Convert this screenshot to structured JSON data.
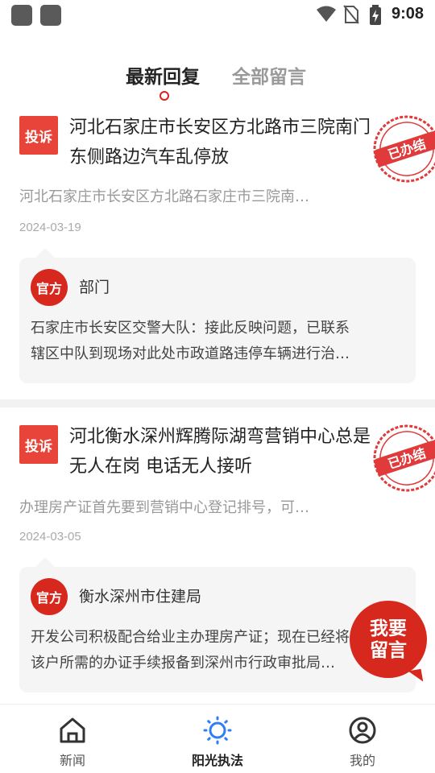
{
  "status_bar": {
    "time": "9:08"
  },
  "tabs": [
    {
      "label": "最新回复",
      "active": true
    },
    {
      "label": "全部留言",
      "active": false
    }
  ],
  "items": [
    {
      "badge": "投诉",
      "title_line1": "河北石家庄市长安区方北路市三院南门",
      "title_line2": "东侧路边汽车乱停放",
      "summary": "河北石家庄市长安区方北路石家庄市三院南…",
      "date": "2024-03-19",
      "stamp": "已办结",
      "reply": {
        "official_label": "官方",
        "department": "部门",
        "line1": "石家庄市长安区交警大队：接此反映问题，已联系",
        "line2": "辖区中队到现场对此处市政道路违停车辆进行治…"
      }
    },
    {
      "badge": "投诉",
      "title_line1": "河北衡水深州辉腾际湖弯营销中心总是",
      "title_line2": "无人在岗 电话无人接听",
      "summary": "办理房产证首先要到营销中心登记排号，可…",
      "date": "2024-03-05",
      "stamp": "已办结",
      "reply": {
        "official_label": "官方",
        "department": "衡水深州市住建局",
        "line1": "开发公司积极配合给业主办理房产证；现在已经将",
        "line2": "该户所需的办证手续报备到深州市行政审批局…"
      }
    }
  ],
  "fab": {
    "line1": "我要",
    "line2": "留言"
  },
  "bottom_nav": [
    {
      "label": "新闻",
      "icon": "home-icon",
      "active": false
    },
    {
      "label": "阳光执法",
      "icon": "sun-icon",
      "active": true
    },
    {
      "label": "我的",
      "icon": "user-icon",
      "active": false
    }
  ],
  "colors": {
    "accent": "#d7281d",
    "badge": "#e8443a",
    "nav_active": "#2f7ef6"
  }
}
